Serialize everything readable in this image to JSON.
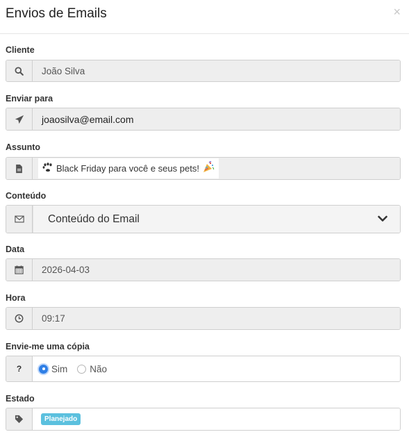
{
  "modal": {
    "title": "Envios de Emails",
    "close_label": "×"
  },
  "fields": {
    "cliente": {
      "label": "Cliente",
      "value": "João Silva"
    },
    "enviar_para": {
      "label": "Enviar para",
      "value": "joaosilva@email.com"
    },
    "assunto": {
      "label": "Assunto",
      "value": "Black Friday para você e seus pets!"
    },
    "conteudo": {
      "label": "Conteúdo",
      "value": "Conteúdo do Email"
    },
    "data": {
      "label": "Data",
      "value": "2026-04-03"
    },
    "hora": {
      "label": "Hora",
      "value": "09:17"
    },
    "copia": {
      "label": "Envie-me uma cópia",
      "addon": "?",
      "options": [
        {
          "label": "Sim",
          "selected": true
        },
        {
          "label": "Não",
          "selected": false
        }
      ]
    },
    "estado": {
      "label": "Estado",
      "badge": "Planejado",
      "badge_color": "#5bc0de"
    }
  },
  "icons": {
    "cliente": "search-icon",
    "enviar_para": "paper-plane-icon",
    "assunto": "document-icon",
    "conteudo": "envelope-icon",
    "data": "calendar-icon",
    "hora": "clock-icon",
    "copia": "question-icon",
    "estado": "tag-icon"
  },
  "colors": {
    "accent_radio": "#2f7fe6",
    "badge": "#5bc0de"
  }
}
